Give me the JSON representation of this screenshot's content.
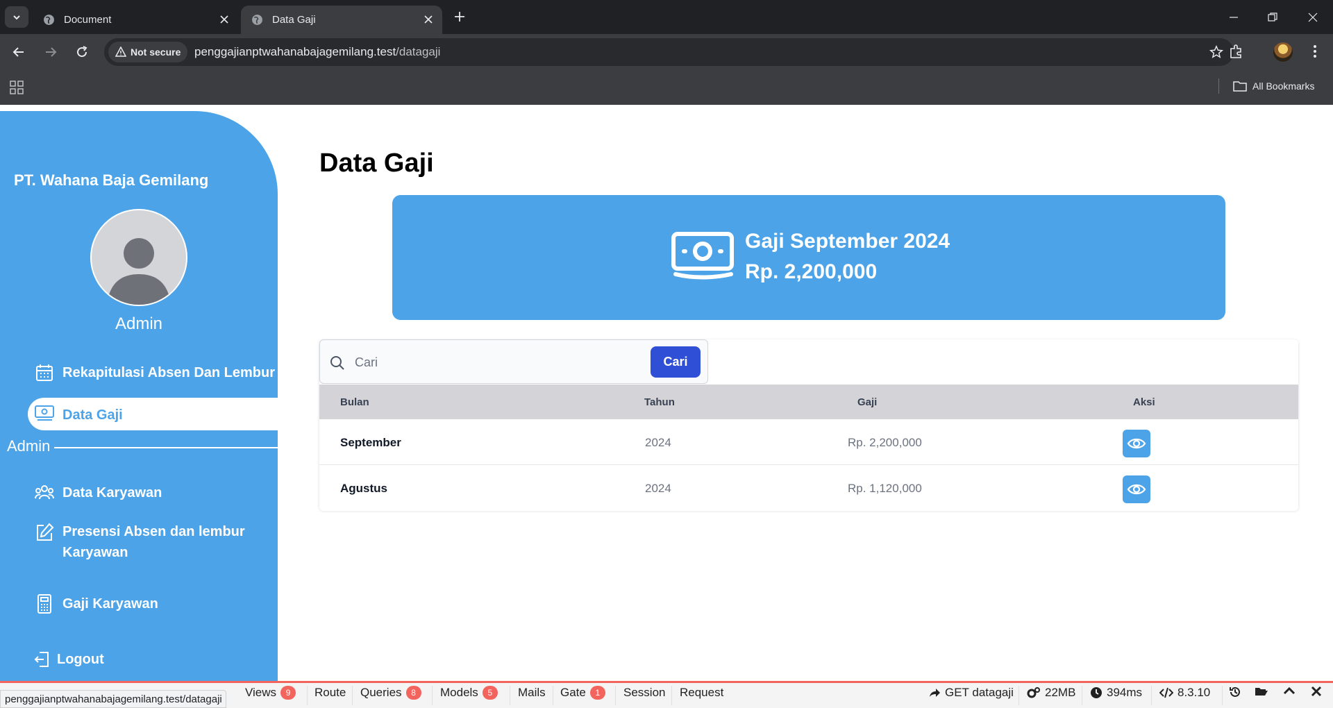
{
  "browser": {
    "tabs": [
      {
        "title": "Document"
      },
      {
        "title": "Data Gaji"
      }
    ],
    "security_label": "Not secure",
    "url_host": "penggajianptwahanabajagemilang.test",
    "url_path": "/datagaji",
    "bookmarks_label": "All Bookmarks",
    "status_url": "penggajianptwahanabajagemilang.test/datagaji"
  },
  "sidebar": {
    "company": "PT. Wahana Baja Gemilang",
    "user_name": "Admin",
    "items": [
      {
        "label": "Rekapitulasi Absen Dan Lembur",
        "icon": "calendar-icon"
      },
      {
        "label": "Data Gaji",
        "icon": "money-icon",
        "active": true
      }
    ],
    "section_label": "Admin",
    "admin_items": [
      {
        "label": "Data Karyawan",
        "icon": "users-icon"
      },
      {
        "label": "Presensi Absen dan lembur",
        "label2": "Karyawan",
        "icon": "edit-icon"
      },
      {
        "label": "Gaji Karyawan",
        "icon": "calculator-icon"
      }
    ],
    "logout": "Logout"
  },
  "main": {
    "title": "Data Gaji",
    "banner": {
      "title": "Gaji September 2024",
      "amount": "Rp. 2,200,000"
    },
    "search": {
      "placeholder": "Cari",
      "button": "Cari"
    },
    "table": {
      "headers": [
        "Bulan",
        "Tahun",
        "Gaji",
        "Aksi"
      ],
      "rows": [
        {
          "bulan": "September",
          "tahun": "2024",
          "gaji": "Rp. 2,200,000"
        },
        {
          "bulan": "Agustus",
          "tahun": "2024",
          "gaji": "Rp. 1,120,000"
        }
      ]
    }
  },
  "debugbar": {
    "tabs": [
      {
        "label": "Views",
        "count": "9"
      },
      {
        "label": "Route"
      },
      {
        "label": "Queries",
        "count": "8"
      },
      {
        "label": "Models",
        "count": "5"
      },
      {
        "label": "Mails"
      },
      {
        "label": "Gate",
        "count": "1"
      },
      {
        "label": "Session"
      },
      {
        "label": "Request"
      }
    ],
    "route": "GET datagaji",
    "memory": "22MB",
    "time": "394ms",
    "php_version": "8.3.10"
  },
  "colors": {
    "sidebar": "#4da3e8",
    "primary_button": "#2f4fd6",
    "debug_accent": "#f4645f"
  }
}
